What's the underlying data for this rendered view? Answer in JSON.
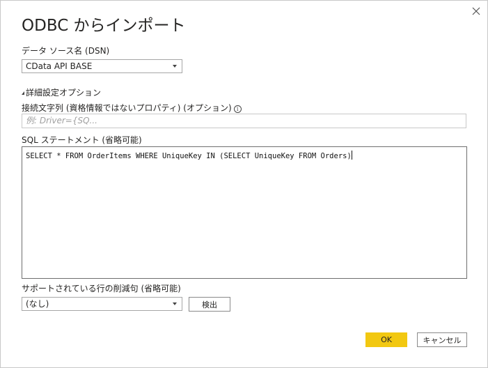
{
  "dialog": {
    "title": "ODBC からインポート",
    "close_icon": "close-icon"
  },
  "dsn": {
    "label": "データ ソース名 (DSN)",
    "selected": "CData API BASE"
  },
  "advanced": {
    "toggle_label": "詳細設定オプション",
    "connection_string_label": "接続文字列 (資格情報ではないプロパティ) (オプション)",
    "connection_string_placeholder": "例: Driver={SQ...",
    "info_icon": "info-icon",
    "sql_label": "SQL ステートメント (省略可能)",
    "sql_value": "SELECT * FROM OrderItems WHERE UniqueKey IN (SELECT UniqueKey FROM Orders)",
    "reduction_label": "サポートされている行の削減句 (省略可能)",
    "reduction_selected": "(なし)",
    "detect_button": "検出"
  },
  "footer": {
    "ok_label": "OK",
    "cancel_label": "キャンセル"
  },
  "colors": {
    "accent": "#f2c811",
    "border": "#c8c8c8"
  }
}
